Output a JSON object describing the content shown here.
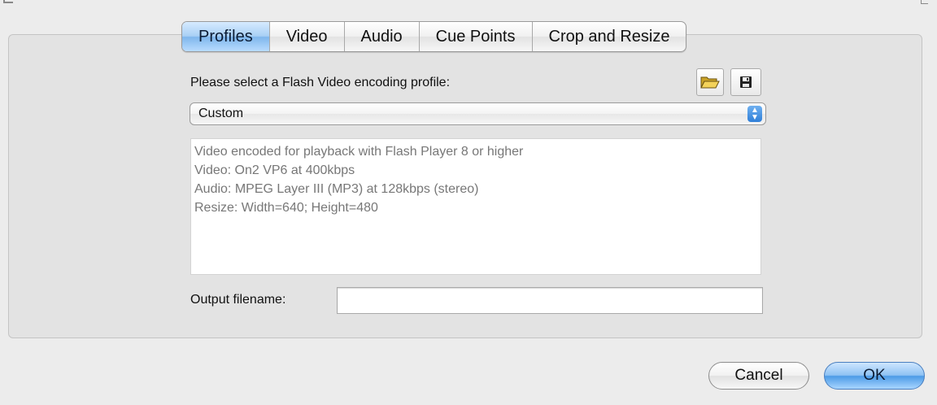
{
  "tabs": [
    {
      "label": "Profiles",
      "active": true
    },
    {
      "label": "Video",
      "active": false
    },
    {
      "label": "Audio",
      "active": false
    },
    {
      "label": "Cue Points",
      "active": false
    },
    {
      "label": "Crop and Resize",
      "active": false
    }
  ],
  "profile": {
    "prompt": "Please select a Flash Video encoding profile:",
    "selected": "Custom",
    "description": [
      "Video encoded for playback with Flash Player 8 or higher",
      "Video: On2 VP6 at 400kbps",
      "Audio: MPEG Layer III (MP3) at 128kbps (stereo)",
      "Resize: Width=640; Height=480"
    ]
  },
  "output": {
    "label": "Output filename:",
    "value": ""
  },
  "buttons": {
    "cancel": "Cancel",
    "ok": "OK"
  },
  "icons": {
    "open": "open-folder-icon",
    "save": "save-disk-icon"
  },
  "colors": {
    "accent": "#7fb6ec",
    "background": "#ececec"
  }
}
